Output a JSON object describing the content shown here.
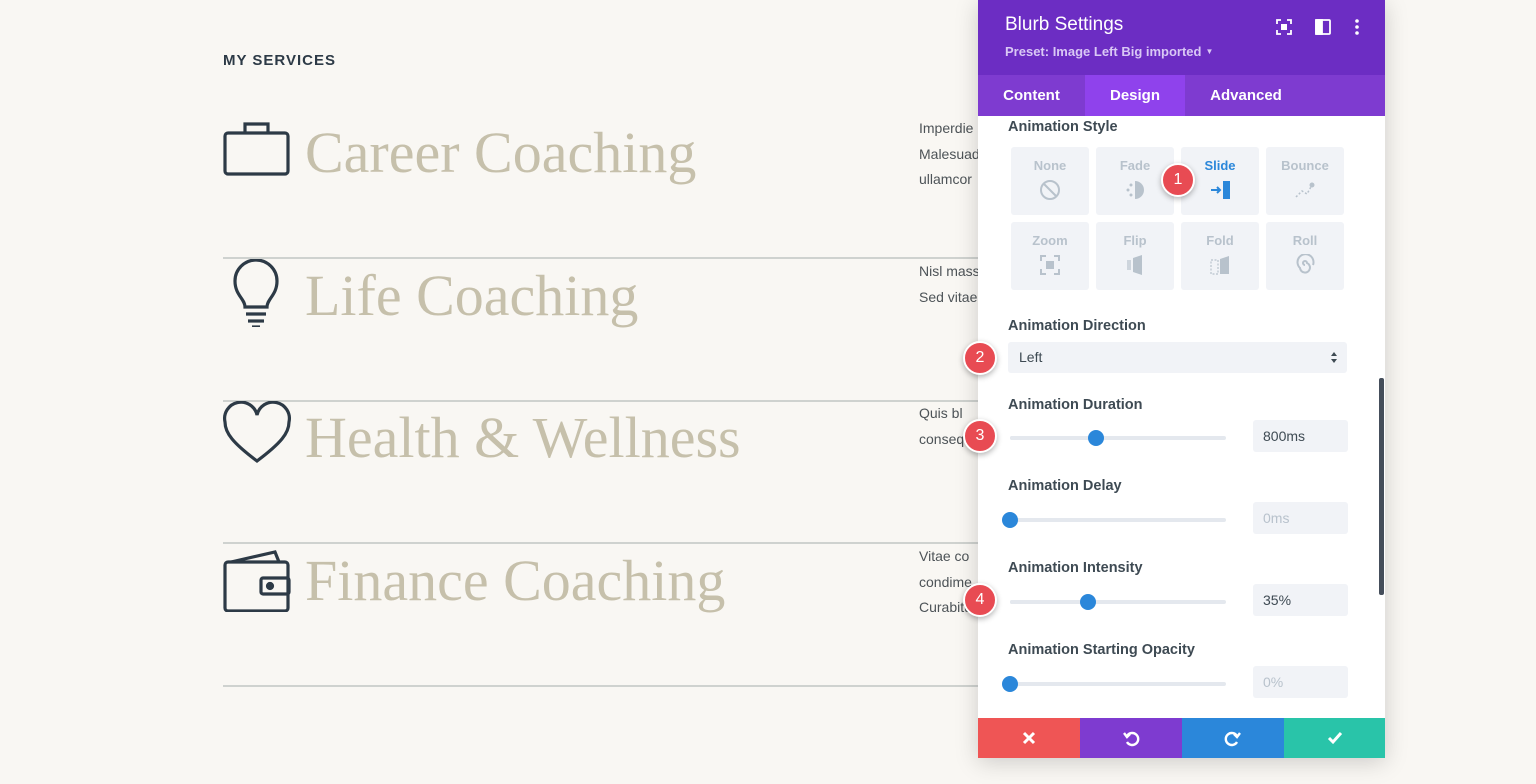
{
  "page": {
    "section_label": "MY SERVICES",
    "services": [
      {
        "title": "Career Coaching",
        "icon": "briefcase-icon",
        "desc": [
          "Imperdie",
          "Malesuad",
          "ullamcor"
        ]
      },
      {
        "title": "Life Coaching",
        "icon": "lightbulb-icon",
        "desc": [
          "Nisl mass",
          "Sed vitae"
        ]
      },
      {
        "title": "Health & Wellness",
        "icon": "heart-icon",
        "desc": [
          "Quis bl",
          "consequa"
        ]
      },
      {
        "title": "Finance Coaching",
        "icon": "wallet-icon",
        "desc": [
          "Vitae co",
          "condime",
          "Curabitu"
        ]
      }
    ]
  },
  "panel": {
    "title": "Blurb Settings",
    "preset": "Preset: Image Left Big imported",
    "header_icons": [
      "focus-icon",
      "split-view-icon",
      "more-vertical-icon"
    ],
    "tabs": [
      "Content",
      "Design",
      "Advanced"
    ],
    "active_tab": "Design",
    "animation_style": {
      "label": "Animation Style",
      "options": [
        "None",
        "Fade",
        "Slide",
        "Bounce",
        "Zoom",
        "Flip",
        "Fold",
        "Roll"
      ],
      "selected": "Slide"
    },
    "animation_direction": {
      "label": "Animation Direction",
      "value": "Left"
    },
    "animation_duration": {
      "label": "Animation Duration",
      "value": "800ms",
      "fraction": 0.4
    },
    "animation_delay": {
      "label": "Animation Delay",
      "value": "0ms",
      "fraction": 0.0
    },
    "animation_intensity": {
      "label": "Animation Intensity",
      "value": "35%",
      "fraction": 0.36
    },
    "animation_opacity": {
      "label": "Animation Starting Opacity",
      "value": "0%",
      "fraction": 0.0
    },
    "footer_buttons": [
      "close-icon",
      "undo-icon",
      "redo-icon",
      "checkmark-icon"
    ]
  },
  "badges": [
    "1",
    "2",
    "3",
    "4"
  ],
  "colors": {
    "panel_header": "#6c2dc3",
    "tabs": "#7e3bd0",
    "active_tab": "#8f42ec",
    "accent_blue": "#2b87da",
    "badge": "#e84b53",
    "title_text": "#c6c0ab",
    "footer": [
      "#ef5555",
      "#7e3bd0",
      "#2b87da",
      "#29c4a9"
    ]
  }
}
